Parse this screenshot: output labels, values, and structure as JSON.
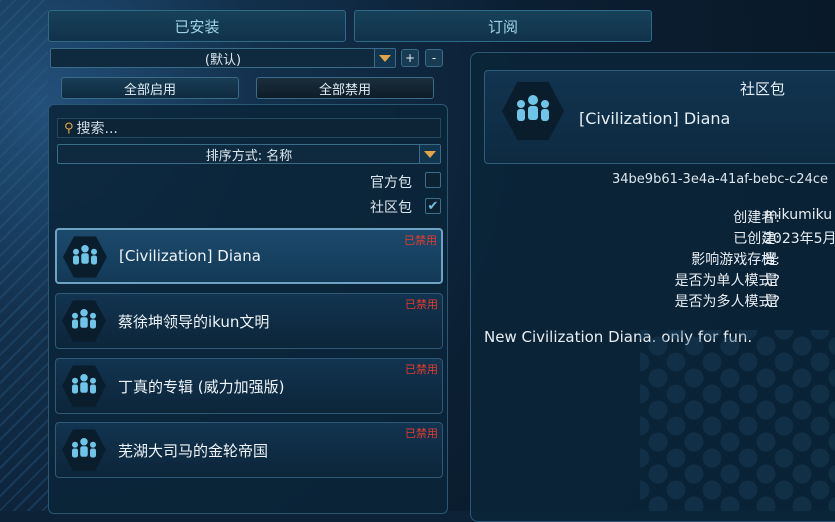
{
  "tabs": {
    "installed": "已安装",
    "subscribed": "订阅"
  },
  "profile": {
    "selected": "(默认)",
    "add": "+",
    "remove": "-"
  },
  "actions": {
    "enable_all": "全部启用",
    "disable_all": "全部禁用"
  },
  "search": {
    "placeholder": "搜索..."
  },
  "sort": {
    "label": "排序方式: 名称"
  },
  "filters": {
    "official": "官方包",
    "official_checked": false,
    "community": "社区包",
    "community_checked": true
  },
  "mods": [
    {
      "title": "[Civilization] Diana",
      "status": "已禁用"
    },
    {
      "title": "蔡徐坤领导的ikun文明",
      "status": "已禁用"
    },
    {
      "title": "丁真的专辑 (威力加强版)",
      "status": "已禁用"
    },
    {
      "title": "芜湖大司马的金轮帝国",
      "status": "已禁用"
    }
  ],
  "detail": {
    "type": "社区包",
    "title": "[Civilization] Diana",
    "id": "34be9b61-3e4a-41af-bebc-c24ce",
    "fields": [
      {
        "k": "创建者:",
        "v": "mikumiku"
      },
      {
        "k": "已创建:",
        "v": "2023年5月"
      },
      {
        "k": "影响游戏存档:",
        "v": "是"
      },
      {
        "k": "是否为单人模式?",
        "v": "是"
      },
      {
        "k": "是否为多人模式?",
        "v": "是"
      }
    ],
    "description": "New Civilization Diana. only for fun."
  },
  "colors": {
    "accent": "#6fc5e8",
    "disabled": "#e33c2e",
    "arrow": "#e0a544"
  }
}
